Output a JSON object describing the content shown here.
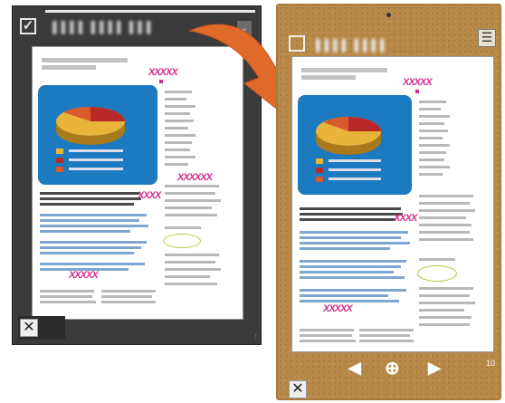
{
  "left_window": {
    "checkbox_glyph": "✓",
    "title": "▐▐▐▐ ▐▐▐▐ ▐▐▐",
    "corner_glyph": "⌄",
    "close_glyph": "✕",
    "grip_glyph": "⁞"
  },
  "right_window": {
    "checkbox_glyph": "",
    "title": "▐▐▐▐ ▐▐▐▐",
    "menu_glyph": "☰",
    "prev_glyph": "◀",
    "add_glyph": "⊕",
    "next_glyph": "▶",
    "page_number": "10",
    "close_glyph": "✕"
  },
  "marks": {
    "xs": "XXXXX",
    "xs_long": "XXXXXX",
    "xs_short": "XXXX"
  },
  "colors": {
    "cork": "#b88a4a",
    "dark_bg": "#3b3b3b",
    "panel_blue": "#1c7ac0",
    "mark_pink": "#d22a8a",
    "arrow_orange": "#e06a2a"
  }
}
